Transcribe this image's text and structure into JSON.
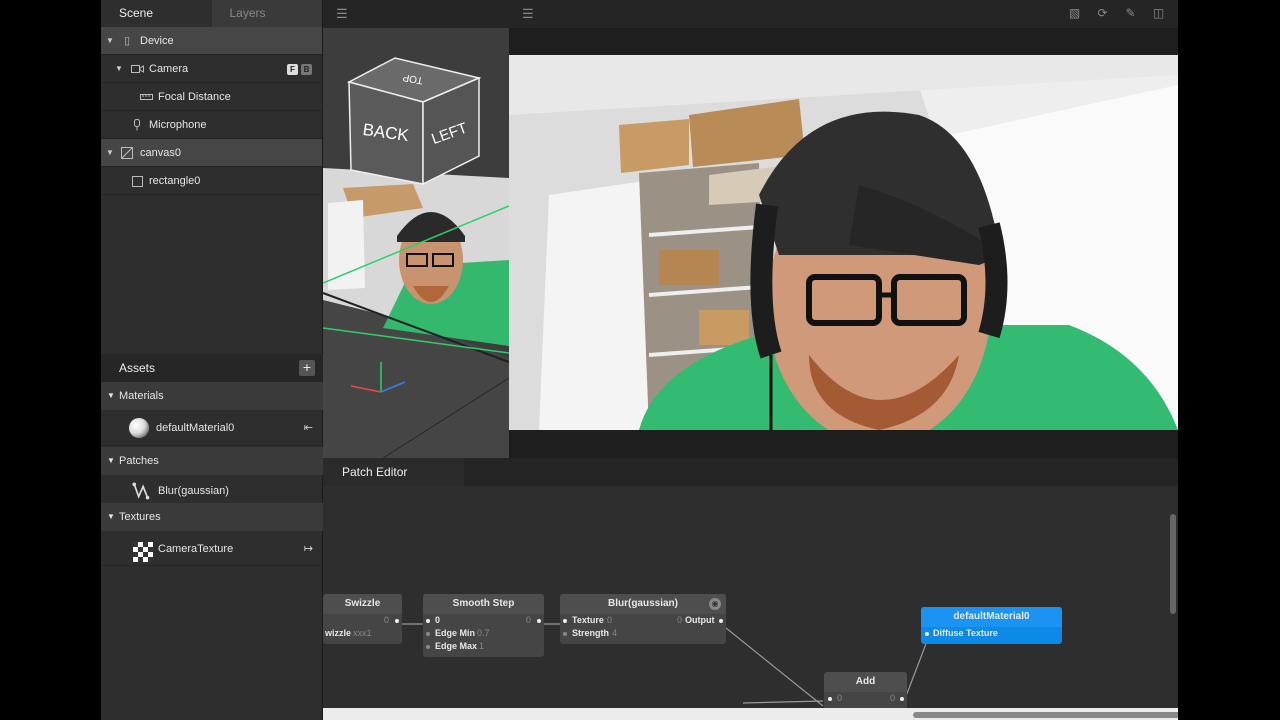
{
  "scene_panel": {
    "tabs": [
      {
        "label": "Scene"
      },
      {
        "label": "Layers"
      }
    ],
    "tree": [
      {
        "label": "Device"
      },
      {
        "label": "Camera",
        "badges": [
          "F",
          "B"
        ]
      },
      {
        "label": "Focal Distance"
      },
      {
        "label": "Microphone"
      },
      {
        "label": "canvas0"
      },
      {
        "label": "rectangle0"
      }
    ]
  },
  "assets": {
    "title": "Assets",
    "add_label": "+",
    "sections": [
      {
        "label": "Materials",
        "items": [
          {
            "label": "defaultMaterial0",
            "icon": "sphere-icon",
            "action": "⇤"
          }
        ]
      },
      {
        "label": "Patches",
        "items": [
          {
            "label": "Blur(gaussian)",
            "icon": "patch-icon"
          }
        ]
      },
      {
        "label": "Textures",
        "items": [
          {
            "label": "CameraTexture",
            "icon": "checker-icon",
            "action": "↦"
          }
        ]
      }
    ]
  },
  "view3d": {
    "cube_faces": {
      "top": "TOP",
      "back": "BACK",
      "left": "LEFT"
    }
  },
  "patch_editor": {
    "tab_label": "Patch Editor",
    "nodes": {
      "swizzle": {
        "title": "Swizzle",
        "in_value": "0",
        "row_label": "wizzle",
        "row_value": "xxx1"
      },
      "smoothstep": {
        "title": "Smooth Step",
        "in_value": "0",
        "out_value": "0",
        "edge_min_label": "Edge Min",
        "edge_min": "0.7",
        "edge_max_label": "Edge Max",
        "edge_max": "1"
      },
      "blur": {
        "title": "Blur(gaussian)",
        "texture_label": "Texture",
        "texture_value": "0",
        "output_value": "0",
        "output_label": "Output",
        "strength_label": "Strength",
        "strength_value": "4"
      },
      "material": {
        "title": "defaultMaterial0",
        "port_label": "Diffuse Texture"
      },
      "add": {
        "title": "Add",
        "in_value": "0",
        "out_value": "0"
      }
    }
  },
  "colors": {
    "accent": "#0d8ae8",
    "axis_green": "#2ecf6b"
  }
}
